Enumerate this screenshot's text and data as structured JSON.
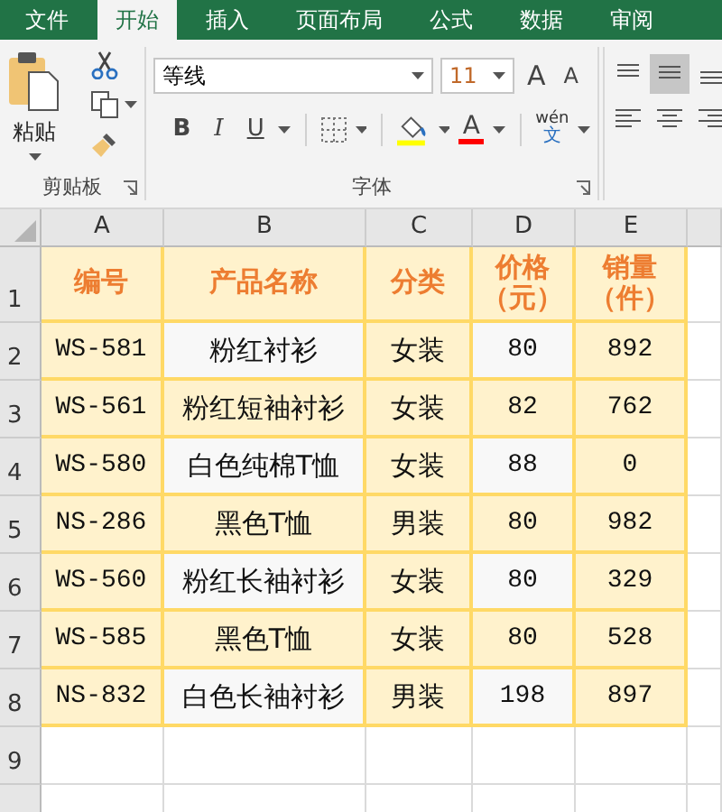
{
  "tabs": [
    {
      "label": "文件",
      "selected": false
    },
    {
      "label": "开始",
      "selected": true
    },
    {
      "label": "插入",
      "selected": false
    },
    {
      "label": "页面布局",
      "selected": false
    },
    {
      "label": "公式",
      "selected": false
    },
    {
      "label": "数据",
      "selected": false
    },
    {
      "label": "审阅",
      "selected": false
    }
  ],
  "clipboard": {
    "paste_label": "粘贴",
    "group_label": "剪贴板"
  },
  "font": {
    "name": "等线",
    "size": "11",
    "grow_label": "A",
    "shrink_label": "A",
    "format_buttons": [
      "B",
      "I",
      "U"
    ],
    "font_color_label": "A",
    "phonetic_top": "wén",
    "phonetic_bottom": "文",
    "group_label": "字体"
  },
  "sheet": {
    "columns": [
      "A",
      "B",
      "C",
      "D",
      "E"
    ],
    "header_row": {
      "number": "1",
      "cells": [
        "编号",
        "产品名称",
        "分类",
        "价格（元）",
        "销量（件）"
      ]
    },
    "rows": [
      {
        "number": "2",
        "highlight": true,
        "cells": [
          "WS-581",
          "粉红衬衫",
          "女装",
          "80",
          "892"
        ]
      },
      {
        "number": "3",
        "highlight": false,
        "cells": [
          "WS-561",
          "粉红短袖衬衫",
          "女装",
          "82",
          "762"
        ]
      },
      {
        "number": "4",
        "highlight": true,
        "cells": [
          "WS-580",
          "白色纯棉T恤",
          "女装",
          "88",
          "0"
        ]
      },
      {
        "number": "5",
        "highlight": false,
        "cells": [
          "NS-286",
          "黑色T恤",
          "男装",
          "80",
          "982"
        ]
      },
      {
        "number": "6",
        "highlight": true,
        "cells": [
          "WS-560",
          "粉红长袖衬衫",
          "女装",
          "80",
          "329"
        ]
      },
      {
        "number": "7",
        "highlight": false,
        "cells": [
          "WS-585",
          "黑色T恤",
          "女装",
          "80",
          "528"
        ]
      },
      {
        "number": "8",
        "highlight": true,
        "cells": [
          "NS-832",
          "白色长袖衬衫",
          "男装",
          "198",
          "897"
        ]
      }
    ],
    "empty_rows": [
      "9"
    ]
  }
}
